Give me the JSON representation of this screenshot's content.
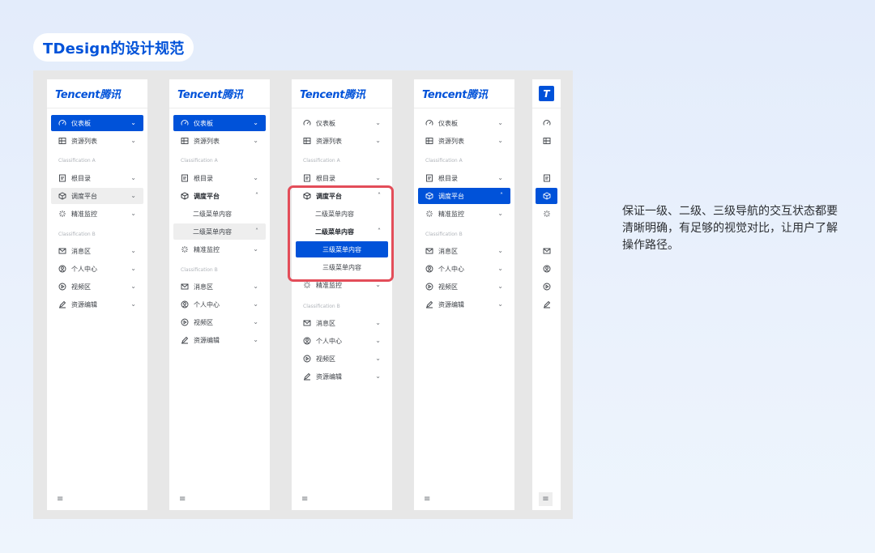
{
  "page_title": "TDesign的设计规范",
  "description": "保证一级、二级、三级导航的交互状态都要清晰明确，有足够的视觉对比，让用户了解操作路径。",
  "brand": {
    "logo_text": "Tencent腾讯",
    "logo_short": "T"
  },
  "colors": {
    "brand_blue": "#0052d9",
    "highlight_red": "#e34d59"
  },
  "nav": {
    "dashboard": "仪表板",
    "resource_list": "资源列表",
    "section_a": "Classification A",
    "root_dir": "根目录",
    "scheduling": "调度平台",
    "precision_monitor": "精准监控",
    "section_b": "Classification B",
    "messages": "消息区",
    "personal_center": "个人中心",
    "video": "视频区",
    "resource_edit": "资源编辑",
    "level2_item": "二级菜单内容",
    "level3_item": "三级菜单内容"
  },
  "icons": {
    "dashboard": "gauge-icon",
    "resource_list": "table-icon",
    "root_dir": "file-icon",
    "scheduling": "cube-icon",
    "precision_monitor": "sparkle-icon",
    "messages": "mail-icon",
    "personal_center": "user-circle-icon",
    "video": "play-circle-icon",
    "resource_edit": "edit-icon",
    "footer": "menu-icon"
  }
}
